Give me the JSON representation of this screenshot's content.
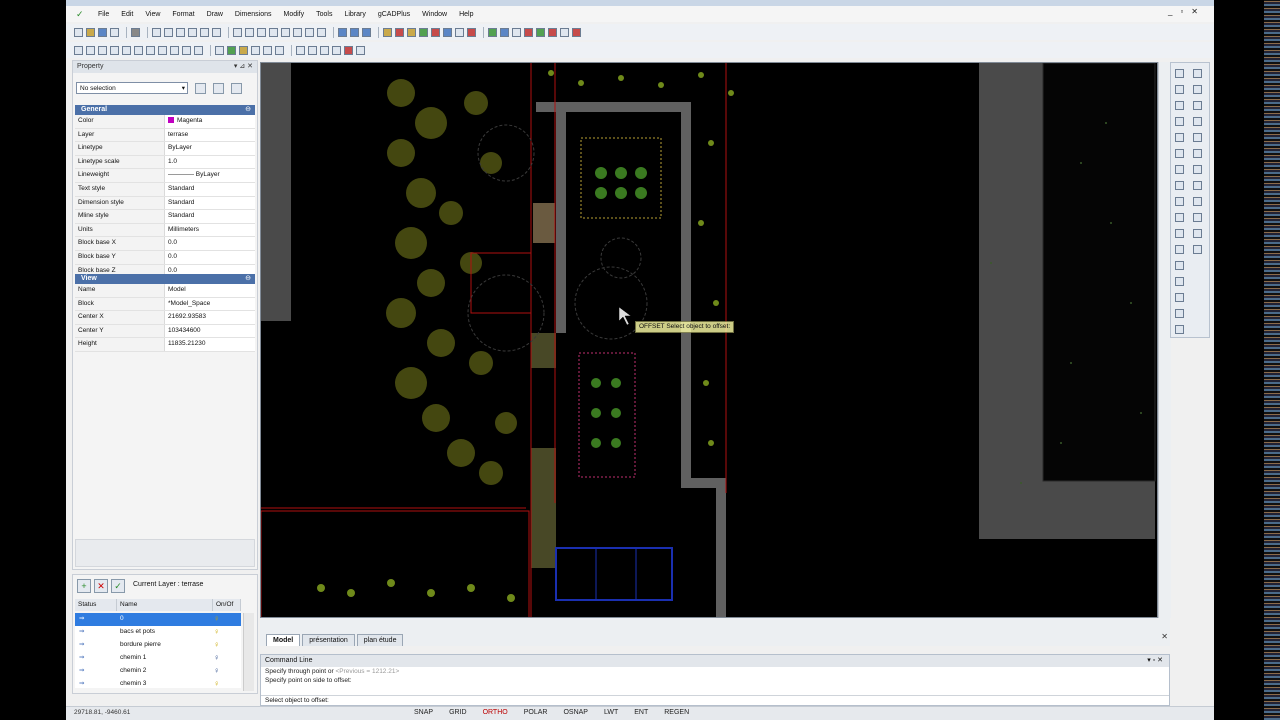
{
  "menu": {
    "items": [
      "File",
      "Edit",
      "View",
      "Format",
      "Draw",
      "Dimensions",
      "Modify",
      "Tools",
      "Library",
      "gCADPlus",
      "Window",
      "Help"
    ]
  },
  "window_controls": {
    "minimize": "_",
    "restore": "▫",
    "close": "✕"
  },
  "property_panel": {
    "title": "Property",
    "selection": "No selection",
    "general": {
      "title": "General",
      "rows": [
        {
          "key": "Color",
          "value": "Magenta"
        },
        {
          "key": "Layer",
          "value": "terrase"
        },
        {
          "key": "Linetype",
          "value": "ByLayer"
        },
        {
          "key": "Linetype scale",
          "value": "1.0"
        },
        {
          "key": "Lineweight",
          "value": "———— ByLayer"
        },
        {
          "key": "Text style",
          "value": "Standard"
        },
        {
          "key": "Dimension style",
          "value": "Standard"
        },
        {
          "key": "Mline style",
          "value": "Standard"
        },
        {
          "key": "Units",
          "value": "Millimeters"
        },
        {
          "key": "Block base X",
          "value": "0.0"
        },
        {
          "key": "Block base Y",
          "value": "0.0"
        },
        {
          "key": "Block base Z",
          "value": "0.0"
        }
      ]
    },
    "view": {
      "title": "View",
      "rows": [
        {
          "key": "Name",
          "value": "Model"
        },
        {
          "key": "Block",
          "value": "*Model_Space"
        },
        {
          "key": "Center X",
          "value": "21692.93583"
        },
        {
          "key": "Center Y",
          "value": "103434600"
        },
        {
          "key": "Height",
          "value": "11835.21230"
        }
      ]
    }
  },
  "layer_panel": {
    "current_layer": "Current Layer : terrase",
    "columns": [
      "Status",
      "Name",
      "On/Of"
    ],
    "rows": [
      {
        "status": "⇒",
        "name": "0",
        "selected": true
      },
      {
        "status": "⇒",
        "name": "bacs et pots",
        "selected": false
      },
      {
        "status": "⇒",
        "name": "bordure pierre",
        "selected": false
      },
      {
        "status": "⇒",
        "name": "chemin 1",
        "selected": false
      },
      {
        "status": "⇒",
        "name": "chemin 2",
        "selected": false
      },
      {
        "status": "⇒",
        "name": "chemin 3",
        "selected": false
      }
    ]
  },
  "drawing": {
    "tooltip": "OFFSET Select object to offset:"
  },
  "tabs": [
    "Model",
    "présentation",
    "plan étude"
  ],
  "command_line": {
    "title": "Command Line",
    "lines": [
      {
        "text": "Specify through point or ",
        "dim": "<Previous = 1212.21>"
      },
      {
        "text": "Specify point on side to offset:",
        "dim": ""
      }
    ],
    "input": "Select object to offset:"
  },
  "status_bar": {
    "coords": "29718.81, -9460.61",
    "buttons": [
      {
        "label": "SNAP",
        "on": false
      },
      {
        "label": "GRID",
        "on": false
      },
      {
        "label": "ORTHO",
        "on": true
      },
      {
        "label": "POLAR",
        "on": false
      },
      {
        "label": "OSNAP",
        "on": false
      },
      {
        "label": "LWT",
        "on": false
      },
      {
        "label": "ENT",
        "on": false
      },
      {
        "label": "REGEN",
        "on": false
      }
    ]
  },
  "colors": {
    "accent": "#4b70a8",
    "selection": "#2f7ce0",
    "magenta": "#c000c0",
    "ortho_on": "#b00000"
  }
}
